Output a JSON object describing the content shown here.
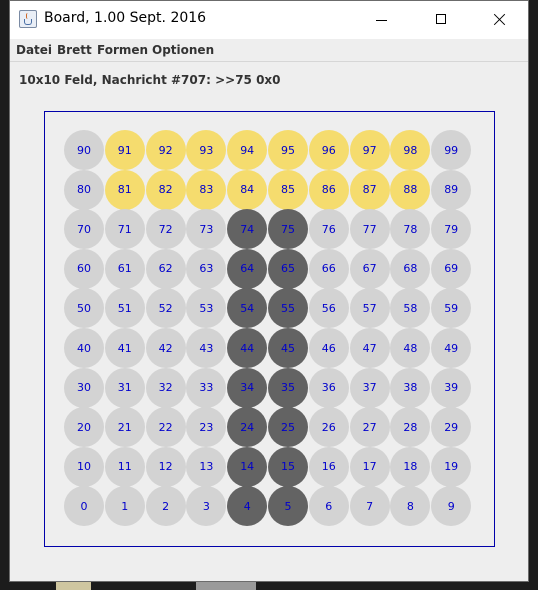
{
  "window": {
    "title": "Board, 1.00 Sept. 2016"
  },
  "menu": [
    "Datei",
    "Brett",
    "Formen",
    "Optionen"
  ],
  "status": "10x10 Feld, Nachricht #707: >>75 0x0",
  "colors": {
    "default": "#d3d3d3",
    "yellow": "#f5dc6e",
    "dark": "#636363",
    "number": "#0000cc",
    "border": "#0000aa"
  },
  "board": {
    "cols": 10,
    "rows": 10,
    "yellow": [
      81,
      82,
      83,
      84,
      85,
      86,
      87,
      88,
      91,
      92,
      93,
      94,
      95,
      96,
      97,
      98
    ],
    "dark": [
      4,
      5,
      14,
      15,
      24,
      25,
      34,
      35,
      44,
      45,
      54,
      55,
      64,
      65,
      74,
      75
    ]
  }
}
